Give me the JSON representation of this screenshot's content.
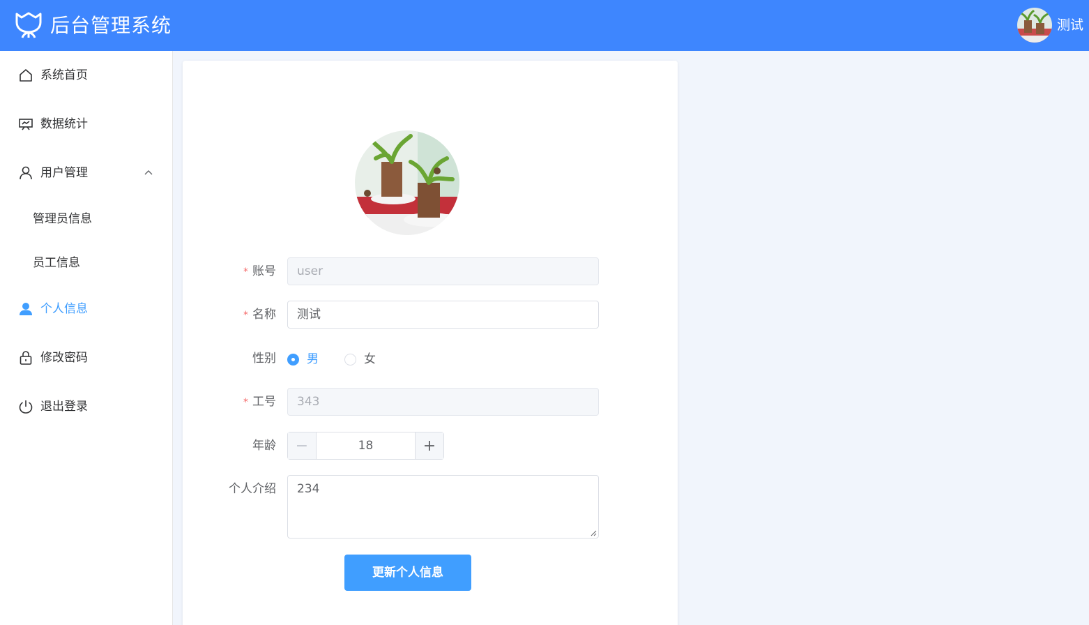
{
  "header": {
    "title": "后台管理系统",
    "user_name": "测试",
    "logo_icon": "tulip-logo-icon",
    "bg_color": "#3e86fe"
  },
  "sidebar": {
    "items": [
      {
        "label": "系统首页",
        "icon": "home-icon"
      },
      {
        "label": "数据统计",
        "icon": "presentation-board-icon"
      },
      {
        "label": "用户管理",
        "icon": "user-outline-icon",
        "expanded": true
      },
      {
        "label": "管理员信息",
        "sub": true
      },
      {
        "label": "员工信息",
        "sub": true
      },
      {
        "label": "个人信息",
        "icon": "user-filled-icon",
        "active": true
      },
      {
        "label": "修改密码",
        "icon": "lock-icon"
      },
      {
        "label": "退出登录",
        "icon": "power-icon"
      }
    ],
    "active_color": "#409eff"
  },
  "form": {
    "account": {
      "label": "账号",
      "value": "user",
      "required": true,
      "disabled": true
    },
    "name": {
      "label": "名称",
      "value": "测试",
      "required": true
    },
    "gender": {
      "label": "性别",
      "options": [
        "男",
        "女"
      ],
      "selected": "男"
    },
    "employee_no": {
      "label": "工号",
      "value": "343",
      "required": true,
      "disabled": true
    },
    "age": {
      "label": "年龄",
      "value": "18"
    },
    "intro": {
      "label": "个人介绍",
      "value": "234"
    },
    "submit_label": "更新个人信息"
  }
}
